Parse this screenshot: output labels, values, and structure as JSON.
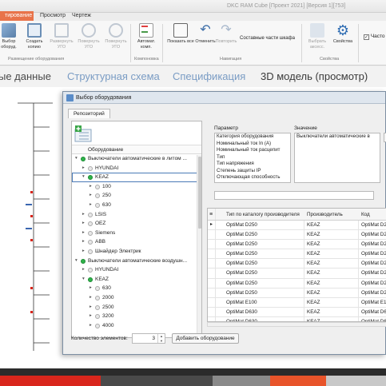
{
  "window_title": "DKC RAM Cube [Проект 2021] [Версия 1][753]",
  "ribbon": {
    "tabs": [
      {
        "label": "тирование",
        "active": true
      },
      {
        "label": "Просмотр",
        "active": false
      },
      {
        "label": "Чертеж",
        "active": false
      }
    ],
    "buttons": {
      "b1": "Выбор оборуд.",
      "b2": "Создать копию",
      "b3": "Развернуть УГО",
      "b4": "Повернуть УГО",
      "b5": "Повернуть УГО",
      "b6": "Автомат. комп.",
      "b7": "Показать все",
      "b8": "Отменить",
      "b9": "Повторить",
      "b10": "Составные части шкафа",
      "b11": "Выбрать аксесс.",
      "b12": "Свойства",
      "b13": "Часто"
    },
    "groups": {
      "g1": "Размещение оборудования",
      "g2": "Компоновка",
      "g3": "Навигация",
      "g4": "Свойства"
    }
  },
  "view_tabs": [
    "ые данные",
    "Структурная схема",
    "Спецификация",
    "3D модель (просмотр)"
  ],
  "dialog": {
    "title": "Выбор оборудования",
    "repo_tab": "Репозиторий",
    "tree_header": "Оборудование",
    "tree": [
      {
        "label": "Выключатели автоматические в литом ...",
        "level": 0,
        "arrow": "▾",
        "dot": "green"
      },
      {
        "label": "HYUNDAI",
        "level": 1,
        "arrow": "▸",
        "dot": "gray"
      },
      {
        "label": "KEAZ",
        "level": 1,
        "arrow": "▾",
        "dot": "green",
        "selected": true
      },
      {
        "label": "100",
        "level": 2,
        "arrow": "▸",
        "dot": "gray"
      },
      {
        "label": "250",
        "level": 2,
        "arrow": "▸",
        "dot": "gray"
      },
      {
        "label": "630",
        "level": 2,
        "arrow": "▸",
        "dot": "gray"
      },
      {
        "label": "LSIS",
        "level": 1,
        "arrow": "▸",
        "dot": "gray"
      },
      {
        "label": "OEZ",
        "level": 1,
        "arrow": "▸",
        "dot": "gray"
      },
      {
        "label": "Siemens",
        "level": 1,
        "arrow": "▸",
        "dot": "gray"
      },
      {
        "label": "ABB",
        "level": 1,
        "arrow": "▸",
        "dot": "gray"
      },
      {
        "label": "Шнайдер Электрик",
        "level": 1,
        "arrow": "▸",
        "dot": "gray"
      },
      {
        "label": "Выключатели автоматические воздушн...",
        "level": 0,
        "arrow": "▾",
        "dot": "green"
      },
      {
        "label": "HYUNDAI",
        "level": 1,
        "arrow": "▸",
        "dot": "gray"
      },
      {
        "label": "KEAZ",
        "level": 1,
        "arrow": "▾",
        "dot": "green"
      },
      {
        "label": "630",
        "level": 2,
        "arrow": "▸",
        "dot": "gray"
      },
      {
        "label": "2000",
        "level": 2,
        "arrow": "▸",
        "dot": "gray"
      },
      {
        "label": "2500",
        "level": 2,
        "arrow": "▸",
        "dot": "gray"
      },
      {
        "label": "3200",
        "level": 2,
        "arrow": "▸",
        "dot": "gray"
      },
      {
        "label": "4000",
        "level": 2,
        "arrow": "▸",
        "dot": "gray"
      }
    ],
    "param_label": "Параметр",
    "value_label": "Значение",
    "params": [
      "Категория оборудования",
      "Номинальный ток In (A)",
      "Номинальный ток расцепит",
      "Тип",
      "Тип напряжения",
      "Степень защиты IP",
      "Отключающая способность"
    ],
    "value": "Выключатели автоматические в",
    "grid": {
      "headers": [
        "Тип по каталогу производителя",
        "Производитель",
        "Код"
      ],
      "rows": [
        [
          "OptiMat D250",
          "KEAZ",
          "OptiMat D250"
        ],
        [
          "OptiMat D250",
          "KEAZ",
          "OptiMat D250"
        ],
        [
          "OptiMat D250",
          "KEAZ",
          "OptiMat D250"
        ],
        [
          "OptiMat D250",
          "KEAZ",
          "OptiMat D250"
        ],
        [
          "OptiMat D250",
          "KEAZ",
          "OptiMat D250"
        ],
        [
          "OptiMat D250",
          "KEAZ",
          "OptiMat D250"
        ],
        [
          "OptiMat D250",
          "KEAZ",
          "OptiMat D250"
        ],
        [
          "OptiMat D250",
          "KEAZ",
          "OptiMat D250"
        ],
        [
          "OptiMat E100",
          "KEAZ",
          "OptiMat E100"
        ],
        [
          "OptiMat D630",
          "KEAZ",
          "OptiMat D630"
        ],
        [
          "OptiMat D630",
          "KEAZ",
          "OptiMat D630"
        ]
      ]
    },
    "count_label": "Количество элементов:",
    "count_value": "3",
    "add_button": "Добавить оборудование"
  },
  "colors": {
    "accent": "#e8734a",
    "brand_red": "#d9261c",
    "green_dot": "#2fb34a",
    "link_blue": "#7a9cc4"
  }
}
